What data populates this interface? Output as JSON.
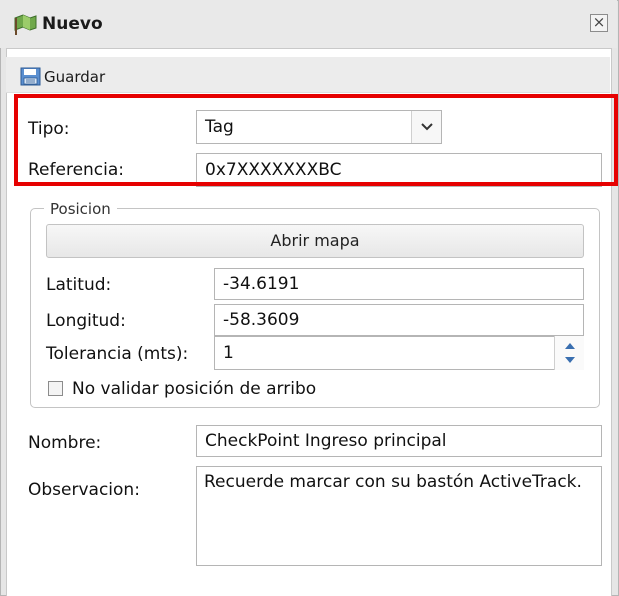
{
  "window": {
    "title": "Nuevo",
    "close_glyph": "×"
  },
  "toolbar": {
    "save_label": "Guardar"
  },
  "form": {
    "tipo_label": "Tipo:",
    "tipo_value": "Tag",
    "referencia_label": "Referencia:",
    "referencia_value": "0x7XXXXXXXBC",
    "position_legend": "Posicion",
    "open_map_label": "Abrir mapa",
    "latitud_label": "Latitud:",
    "latitud_value": "-34.6191",
    "longitud_label": "Longitud:",
    "longitud_value": "-58.3609",
    "tolerancia_label": "Tolerancia (mts):",
    "tolerancia_value": "1",
    "no_validar_label": "No validar posición de arribo",
    "no_validar_checked": false,
    "nombre_label": "Nombre:",
    "nombre_value": "CheckPoint Ingreso principal",
    "observacion_label": "Observacion:",
    "observacion_value": "Recuerde marcar con su bastón ActiveTrack."
  },
  "colors": {
    "highlight": "#e60000"
  },
  "icons": {
    "title": "flag-icon",
    "save": "save-icon",
    "select": "chevron-down-icon",
    "spinner": "spinner-arrows-icon"
  }
}
